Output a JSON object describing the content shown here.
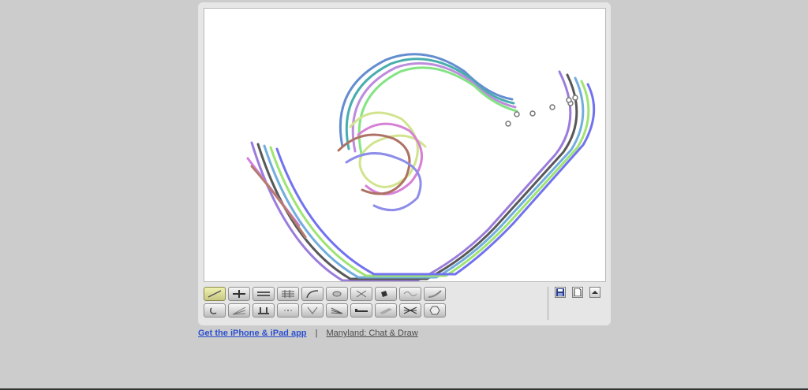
{
  "footer": {
    "app_link": "Get the iPhone & iPad app",
    "separator": "|",
    "manyland_link": "Manyland: Chat & Draw"
  },
  "toolbar": {
    "row1": [
      {
        "icon": "sketchy-brush-icon",
        "active": true
      },
      {
        "icon": "shaded-brush-icon"
      },
      {
        "icon": "chrome-brush-icon"
      },
      {
        "icon": "fur-brush-icon"
      },
      {
        "icon": "longfur-brush-icon"
      },
      {
        "icon": "web-brush-icon"
      },
      {
        "icon": "squares-brush-icon"
      },
      {
        "icon": "ribbon-brush-icon"
      },
      {
        "icon": "wave-brush-icon"
      },
      {
        "icon": "curve-brush-icon"
      }
    ],
    "row2": [
      {
        "icon": "circles-brush-icon"
      },
      {
        "icon": "grid-brush-icon"
      },
      {
        "icon": "columns-brush-icon"
      },
      {
        "icon": "dots-brush-icon"
      },
      {
        "icon": "spray-brush-icon"
      },
      {
        "icon": "streak-brush-icon"
      },
      {
        "icon": "line-brush-icon"
      },
      {
        "icon": "shadow-brush-icon"
      },
      {
        "icon": "cross-brush-icon"
      },
      {
        "icon": "hexagon-brush-icon"
      }
    ]
  },
  "actions": [
    {
      "icon": "save-icon"
    },
    {
      "icon": "new-page-icon"
    },
    {
      "icon": "collapse-icon"
    }
  ],
  "colors": {
    "page_bg": "#cccccc",
    "panel_bg": "#e6e6e6",
    "link_blue": "#2a4fcf",
    "active_tool": "#e0e09a"
  }
}
